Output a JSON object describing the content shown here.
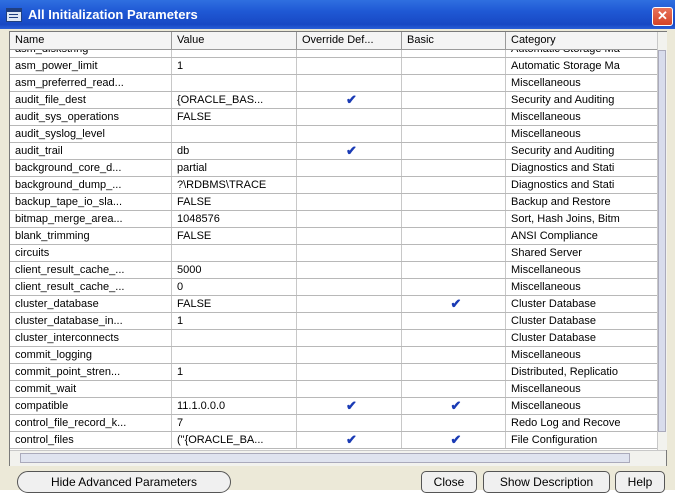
{
  "window": {
    "title": "All Initialization Parameters",
    "close_glyph": "✕"
  },
  "columns": [
    "Name",
    "Value",
    "Override Def...",
    "Basic",
    "Category"
  ],
  "rows": [
    {
      "name": "asm_diskstring",
      "value": "",
      "override": false,
      "basic": false,
      "category": "Automatic Storage Ma"
    },
    {
      "name": "asm_power_limit",
      "value": "1",
      "override": false,
      "basic": false,
      "category": "Automatic Storage Ma"
    },
    {
      "name": "asm_preferred_read...",
      "value": "",
      "override": false,
      "basic": false,
      "category": "Miscellaneous"
    },
    {
      "name": "audit_file_dest",
      "value": "{ORACLE_BAS...",
      "override": true,
      "basic": false,
      "category": "Security and Auditing"
    },
    {
      "name": "audit_sys_operations",
      "value": "FALSE",
      "override": false,
      "basic": false,
      "category": "Miscellaneous"
    },
    {
      "name": "audit_syslog_level",
      "value": "",
      "override": false,
      "basic": false,
      "category": "Miscellaneous"
    },
    {
      "name": "audit_trail",
      "value": "db",
      "override": true,
      "basic": false,
      "category": "Security and Auditing"
    },
    {
      "name": "background_core_d...",
      "value": "partial",
      "override": false,
      "basic": false,
      "category": "Diagnostics and Stati"
    },
    {
      "name": "background_dump_...",
      "value": "?\\RDBMS\\TRACE",
      "override": false,
      "basic": false,
      "category": "Diagnostics and Stati"
    },
    {
      "name": "backup_tape_io_sla...",
      "value": "FALSE",
      "override": false,
      "basic": false,
      "category": "Backup and Restore"
    },
    {
      "name": "bitmap_merge_area...",
      "value": "1048576",
      "override": false,
      "basic": false,
      "category": "Sort, Hash Joins, Bitm"
    },
    {
      "name": "blank_trimming",
      "value": "FALSE",
      "override": false,
      "basic": false,
      "category": "ANSI Compliance"
    },
    {
      "name": "circuits",
      "value": "",
      "override": false,
      "basic": false,
      "category": "Shared Server"
    },
    {
      "name": "client_result_cache_...",
      "value": "5000",
      "override": false,
      "basic": false,
      "category": "Miscellaneous"
    },
    {
      "name": "client_result_cache_...",
      "value": "0",
      "override": false,
      "basic": false,
      "category": "Miscellaneous"
    },
    {
      "name": "cluster_database",
      "value": "FALSE",
      "override": false,
      "basic": true,
      "category": "Cluster Database"
    },
    {
      "name": "cluster_database_in...",
      "value": "1",
      "override": false,
      "basic": false,
      "category": "Cluster Database"
    },
    {
      "name": "cluster_interconnects",
      "value": "",
      "override": false,
      "basic": false,
      "category": "Cluster Database"
    },
    {
      "name": "commit_logging",
      "value": "",
      "override": false,
      "basic": false,
      "category": "Miscellaneous"
    },
    {
      "name": "commit_point_stren...",
      "value": "1",
      "override": false,
      "basic": false,
      "category": "Distributed, Replicatio"
    },
    {
      "name": "commit_wait",
      "value": "",
      "override": false,
      "basic": false,
      "category": "Miscellaneous"
    },
    {
      "name": "compatible",
      "value": "11.1.0.0.0",
      "override": true,
      "basic": true,
      "category": "Miscellaneous"
    },
    {
      "name": "control_file_record_k...",
      "value": "7",
      "override": false,
      "basic": false,
      "category": "Redo Log and Recove"
    },
    {
      "name": "control_files",
      "value": "(\"{ORACLE_BA...",
      "override": true,
      "basic": true,
      "category": "File Configuration"
    }
  ],
  "check_glyph": "✔",
  "buttons": {
    "hide_advanced": "Hide Advanced Parameters",
    "close": "Close",
    "show_description": "Show Description",
    "help": "Help"
  },
  "colors": {
    "titlebar": "#1f58d4",
    "check": "#1a3bb5"
  }
}
